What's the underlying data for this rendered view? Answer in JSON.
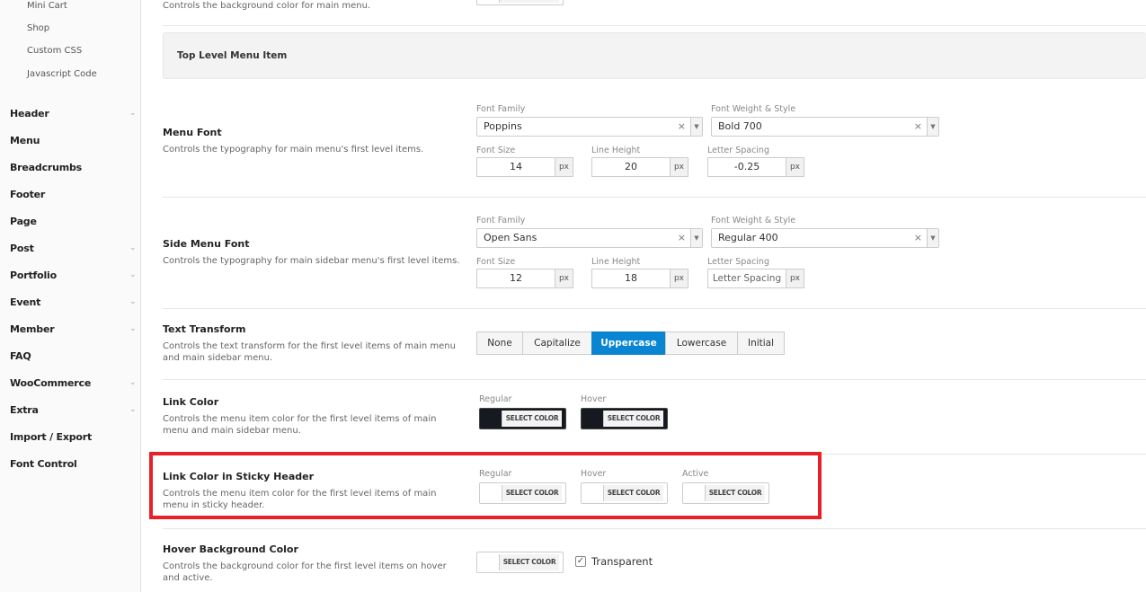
{
  "sidebar": {
    "sub_items": [
      "Mini Cart",
      "Shop",
      "Custom CSS",
      "Javascript Code"
    ],
    "items": [
      "Header",
      "Menu",
      "Breadcrumbs",
      "Footer",
      "Page",
      "Post",
      "Portfolio",
      "Event",
      "Member",
      "FAQ",
      "WooCommerce",
      "Extra",
      "Import / Export",
      "Font Control"
    ]
  },
  "top": {
    "desc": "Controls the background color for main menu."
  },
  "section_header": "Top Level Menu Item",
  "menu_font": {
    "title": "Menu Font",
    "desc": "Controls the typography for main menu's first level items.",
    "family_label": "Font Family",
    "family": "Poppins",
    "weight_label": "Font Weight & Style",
    "weight": "Bold 700",
    "size_label": "Font Size",
    "size": "14",
    "lh_label": "Line Height",
    "lh": "20",
    "ls_label": "Letter Spacing",
    "ls": "-0.25",
    "unit": "px"
  },
  "side_font": {
    "title": "Side Menu Font",
    "desc": "Controls the typography for main sidebar menu's first level items.",
    "family_label": "Font Family",
    "family": "Open Sans",
    "weight_label": "Font Weight & Style",
    "weight": "Regular 400",
    "size_label": "Font Size",
    "size": "12",
    "lh_label": "Line Height",
    "lh": "18",
    "ls_label": "Letter Spacing",
    "ls_placeholder": "Letter Spacing",
    "unit": "px"
  },
  "text_transform": {
    "title": "Text Transform",
    "desc": "Controls the text transform for the first level items of main menu and main sidebar menu.",
    "options": [
      "None",
      "Capitalize",
      "Uppercase",
      "Lowercase",
      "Initial"
    ],
    "selected": "Uppercase"
  },
  "link_color": {
    "title": "Link Color",
    "desc": "Controls the menu item color for the first level items of main menu and main sidebar menu.",
    "regular": "Regular",
    "hover": "Hover",
    "button": "SELECT COLOR"
  },
  "sticky": {
    "title": "Link Color in Sticky Header",
    "desc": "Controls the menu item color for the first level items of main menu in sticky header.",
    "regular": "Regular",
    "hover": "Hover",
    "active": "Active",
    "button": "SELECT COLOR"
  },
  "hover_bg": {
    "title": "Hover Background Color",
    "desc": "Controls the background color for the first level items on hover and active.",
    "button": "SELECT COLOR",
    "transparent": "Transparent",
    "transparent_checked": true
  },
  "colors": {
    "accent": "#0a85d1",
    "highlight": "#e8202a",
    "dark_swatch": "#161a20"
  }
}
